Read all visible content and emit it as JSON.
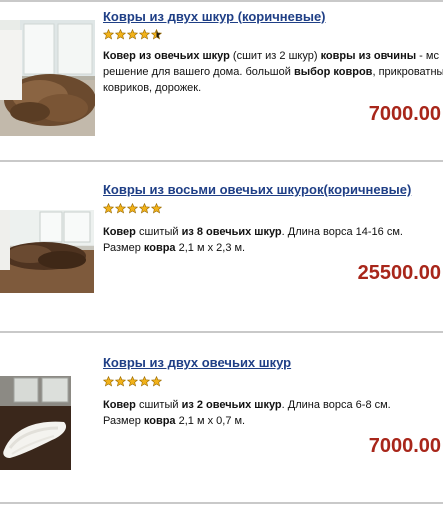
{
  "products": [
    {
      "title": "Ковры из двух шкур (коричневые)",
      "rating": 4.5,
      "desc_line1": [
        {
          "t": "Ковер из овечьих шкур",
          "b": true
        },
        {
          "t": " (сшит из 2 шкур) ",
          "b": false
        },
        {
          "t": "ковры из овчины",
          "b": true
        },
        {
          "t": " - мс",
          "b": false
        }
      ],
      "desc_line2": [
        {
          "t": "решение для вашего дома. большой ",
          "b": false
        },
        {
          "t": "выбор ковров",
          "b": true
        },
        {
          "t": ", прикроватны",
          "b": false
        }
      ],
      "desc_line3": [
        {
          "t": "ковриков, дорожек.",
          "b": false
        }
      ],
      "price": "7000.00"
    },
    {
      "title": "Ковры из восьми овечьих шкурок(коричневые)",
      "rating": 5,
      "desc_line1": [
        {
          "t": "Ковер",
          "b": true
        },
        {
          "t": " сшитый ",
          "b": false
        },
        {
          "t": "из 8 овечьих шкур",
          "b": true
        },
        {
          "t": ". Длина ворса 14-16 см.",
          "b": false
        }
      ],
      "desc_line2": [
        {
          "t": "Размер ",
          "b": false
        },
        {
          "t": "ковра",
          "b": true
        },
        {
          "t": " 2,1 м х 2,3 м.",
          "b": false
        }
      ],
      "desc_line3": [],
      "price": "25500.00"
    },
    {
      "title": "Ковры из двух овечьих шкур",
      "rating": 5,
      "desc_line1": [
        {
          "t": "Ковер",
          "b": true
        },
        {
          "t": " сшитый ",
          "b": false
        },
        {
          "t": "из 2 овечьих шкур",
          "b": true
        },
        {
          "t": ". Длина ворса 6-8 см.",
          "b": false
        }
      ],
      "desc_line2": [
        {
          "t": "Размер ",
          "b": false
        },
        {
          "t": "ковра",
          "b": true
        },
        {
          "t": " 2,1 м х 0,7 м.",
          "b": false
        }
      ],
      "desc_line3": [],
      "price": "7000.00"
    }
  ],
  "colors": {
    "title": "#1f3f86",
    "price": "#a8261a",
    "star_fill": "#f2b21a",
    "star_stroke": "#9a6a00",
    "divider": "#c9c9c9"
  }
}
